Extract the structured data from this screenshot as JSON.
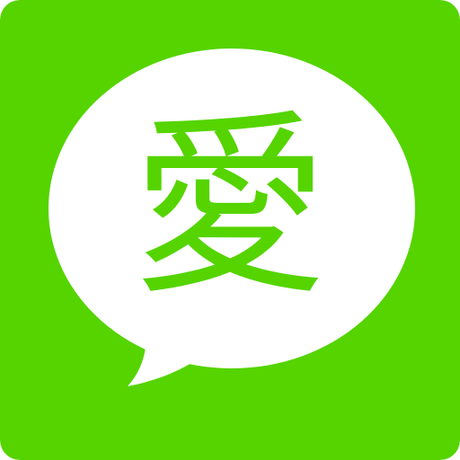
{
  "icon": {
    "name": "chat-bubble-icon",
    "background_color": "#55d400",
    "bubble_color": "#ffffff",
    "glyph_text": "愛",
    "glyph_color": "#55d400"
  }
}
